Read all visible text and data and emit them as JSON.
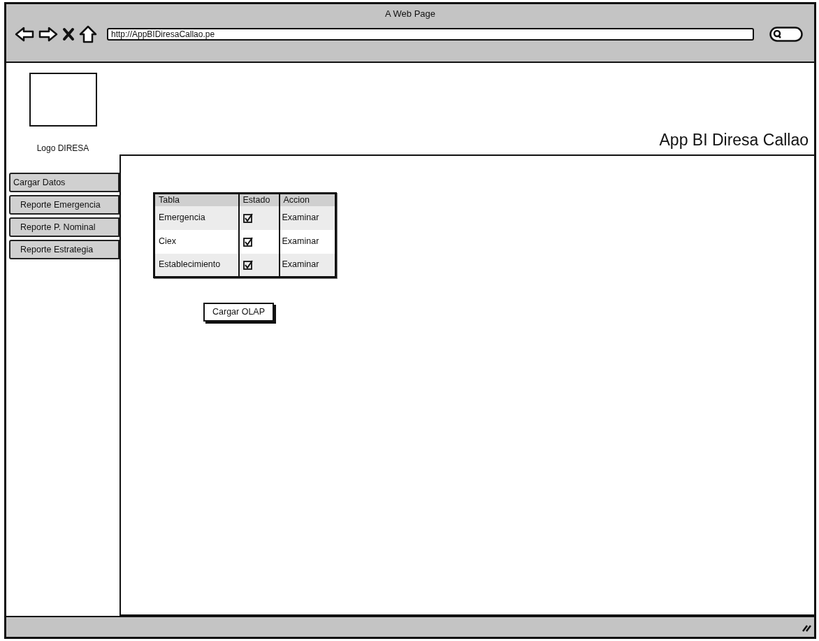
{
  "window": {
    "title": "A Web Page",
    "url": "http://AppBIDiresaCallao.pe"
  },
  "header": {
    "logo_label": "Logo DIRESA",
    "app_title": "App BI Diresa Callao"
  },
  "sidebar": {
    "items": [
      {
        "label": "Cargar Datos"
      },
      {
        "label": "Reporte Emergencia"
      },
      {
        "label": "Reporte P. Nominal"
      },
      {
        "label": "Reporte Estrategia"
      }
    ]
  },
  "table": {
    "columns": [
      "Tabla",
      "Estado",
      "Accion"
    ],
    "rows": [
      {
        "tabla": "Emergencia",
        "checked": true,
        "action": "Examinar"
      },
      {
        "tabla": "Ciex",
        "checked": true,
        "action": "Examinar"
      },
      {
        "tabla": "Establecimiento",
        "checked": true,
        "action": "Examinar"
      }
    ]
  },
  "button": "Cargar OLAP"
}
